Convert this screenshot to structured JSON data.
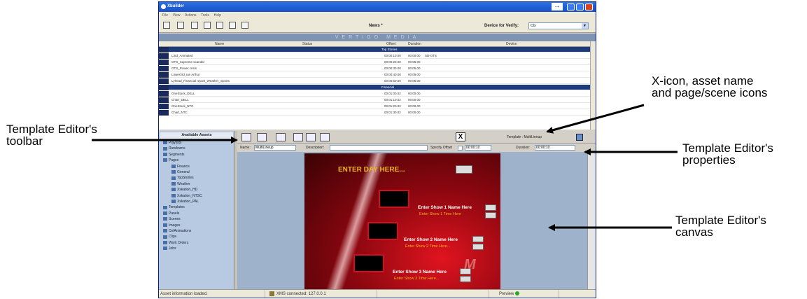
{
  "window": {
    "title": "Xbuilder",
    "menu": [
      "File",
      "View",
      "Actions",
      "Tools",
      "Help"
    ],
    "toolbar_title": "News *",
    "device_verify_label": "Device for Verify:",
    "device_verify_value": "CG"
  },
  "playlist": {
    "brand": "VERTIGO MEDIA",
    "columns": [
      "Name",
      "Status",
      "Offset",
      "Duration",
      "Device"
    ],
    "rows": [
      {
        "section": "Top Stories"
      },
      {
        "name": "L3rd_Animated",
        "offset": "00:00:10.00",
        "duration": "00:00:00",
        "device": "SD-OTS"
      },
      {
        "name": "OTS_Supreme scandal",
        "offset": "00:00:20.00",
        "duration": "00:05.00",
        "device": ""
      },
      {
        "name": "OTS_Power crisis",
        "offset": "00:00:30.00",
        "duration": "00:05.00",
        "device": ""
      },
      {
        "name": "Lower3rd_ian Arthur",
        "offset": "00:00:40.00",
        "duration": "00:05.00",
        "device": ""
      },
      {
        "name": "Lyhead_Financial report_Weather_Sports",
        "offset": "00:00:50.00",
        "duration": "00:05.00",
        "device": ""
      },
      {
        "section": "Financial"
      },
      {
        "name": "OneStock_DELL",
        "offset": "00:01:00.02",
        "duration": "00:00.00",
        "device": ""
      },
      {
        "name": "Chart_DELL",
        "offset": "00:01:10.02",
        "duration": "00:00.00",
        "device": ""
      },
      {
        "name": "OneStock_NTC",
        "offset": "00:01:20.02",
        "duration": "00:00.00",
        "device": ""
      },
      {
        "name": "Chart_NTC",
        "offset": "00:01:30.02",
        "duration": "00:00.00",
        "device": ""
      }
    ]
  },
  "assets": {
    "header": "Available Assets",
    "tree": [
      {
        "label": "Playlists",
        "level": 0
      },
      {
        "label": "Rundowns",
        "level": 0
      },
      {
        "label": "Segments",
        "level": 0
      },
      {
        "label": "Pages",
        "level": 0
      },
      {
        "label": "Finance",
        "level": 1
      },
      {
        "label": "General",
        "level": 1
      },
      {
        "label": "TopStories",
        "level": 1
      },
      {
        "label": "Weather",
        "level": 1
      },
      {
        "label": "Xskation_HD",
        "level": 1
      },
      {
        "label": "Xskation_NTSC",
        "level": 1
      },
      {
        "label": "Xskation_PAL",
        "level": 1
      },
      {
        "label": "Templates",
        "level": 0
      },
      {
        "label": "Panels",
        "level": 0
      },
      {
        "label": "Scenes",
        "level": 0
      },
      {
        "label": "Images",
        "level": 0
      },
      {
        "label": "CelAnimations",
        "level": 0
      },
      {
        "label": "Clips",
        "level": 0
      },
      {
        "label": "Work Orders",
        "level": 0
      },
      {
        "label": "Jobs",
        "level": 0
      }
    ]
  },
  "editor": {
    "x_icon": "X",
    "template_name": "Template : MultiLineup",
    "name_label": "Name:",
    "name_value": "MultiLineup",
    "description_label": "Description:",
    "offset_label": "Specify Offset",
    "offset_value": "00:00:10",
    "duration_label": "Duration:",
    "duration_value": "00:00:10",
    "canvas": {
      "enter_day": "ENTER DAY HERE...",
      "shows": [
        {
          "name": "Enter Show 1 Name Here",
          "time": "Enter Show 1 Time Here"
        },
        {
          "name": "Enter Show 2 Name Here",
          "time": "Enter Show 2 Time Here..."
        },
        {
          "name": "Enter Show 3 Name Here",
          "time": "Enter Show 3 Time Here..."
        }
      ],
      "logo": "M"
    }
  },
  "statusbar": {
    "message": "Asset information loaded.",
    "connection": "XMS connected: 127.0.0.1",
    "preview": "Preview"
  },
  "callouts": {
    "x_icon": [
      "X-icon, asset name",
      "and page/scene icons"
    ],
    "toolbar": [
      "Template Editor's",
      "toolbar"
    ],
    "properties": [
      "Template Editor's",
      "properties"
    ],
    "canvas": [
      "Template Editor's",
      "canvas"
    ]
  }
}
